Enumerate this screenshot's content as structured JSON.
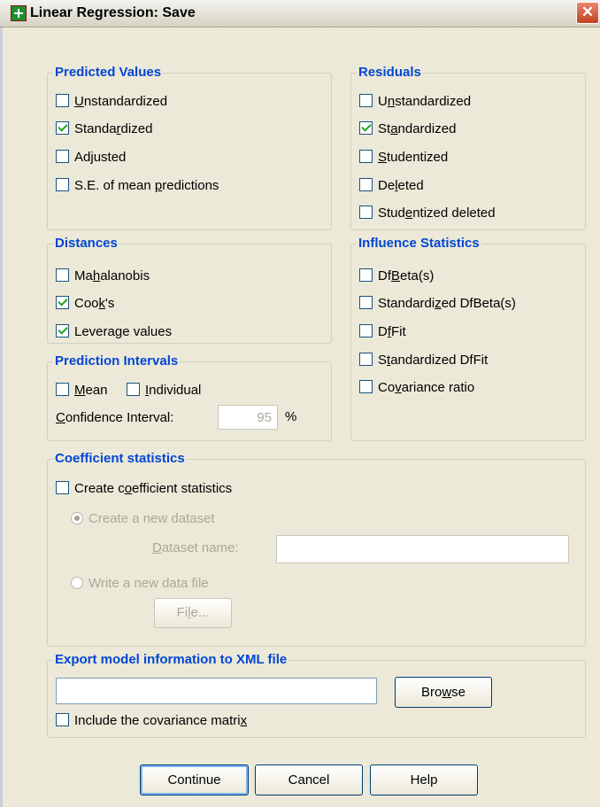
{
  "window": {
    "title": "Linear Regression: Save",
    "close_glyph": "✕"
  },
  "predicted_values": {
    "legend": "Predicted Values",
    "items": [
      {
        "pre": "",
        "u": "U",
        "post": "nstandardized",
        "checked": false
      },
      {
        "pre": "Standa",
        "u": "r",
        "post": "dized",
        "checked": true
      },
      {
        "pre": "Ad",
        "u": "j",
        "post": "usted",
        "checked": false
      },
      {
        "pre": "S.E. of mean ",
        "u": "p",
        "post": "redictions",
        "checked": false
      }
    ]
  },
  "residuals": {
    "legend": "Residuals",
    "items": [
      {
        "pre": "U",
        "u": "n",
        "post": "standardized",
        "checked": false
      },
      {
        "pre": "St",
        "u": "a",
        "post": "ndardized",
        "checked": true
      },
      {
        "pre": "",
        "u": "S",
        "post": "tudentized",
        "checked": false
      },
      {
        "pre": "De",
        "u": "l",
        "post": "eted",
        "checked": false
      },
      {
        "pre": "Stud",
        "u": "e",
        "post": "ntized deleted",
        "checked": false
      }
    ]
  },
  "distances": {
    "legend": "Distances",
    "items": [
      {
        "pre": "Ma",
        "u": "h",
        "post": "alanobis",
        "checked": false
      },
      {
        "pre": "Coo",
        "u": "k",
        "post": "'s",
        "checked": true
      },
      {
        "pre": "Levera",
        "u": "g",
        "post": "e values",
        "checked": true
      }
    ]
  },
  "influence": {
    "legend": "Influence Statistics",
    "items": [
      {
        "pre": "Df",
        "u": "B",
        "post": "eta(s)",
        "checked": false
      },
      {
        "pre": "Standardi",
        "u": "z",
        "post": "ed DfBeta(s)",
        "checked": false
      },
      {
        "pre": "D",
        "u": "f",
        "post": "Fit",
        "checked": false
      },
      {
        "pre": "S",
        "u": "t",
        "post": "andardized DfFit",
        "checked": false
      },
      {
        "pre": "Co",
        "u": "v",
        "post": "ariance ratio",
        "checked": false
      }
    ]
  },
  "prediction_intervals": {
    "legend": "Prediction Intervals",
    "mean": {
      "pre": "",
      "u": "M",
      "post": "ean",
      "checked": false
    },
    "individual": {
      "pre": "",
      "u": "I",
      "post": "ndividual",
      "checked": false
    },
    "ci_label": {
      "pre": "",
      "u": "C",
      "post": "onfidence Interval:"
    },
    "ci_value": "95",
    "ci_unit": "%"
  },
  "coefficient": {
    "legend": "Coefficient statistics",
    "create": {
      "pre": "Create c",
      "u": "o",
      "post": "efficient statistics",
      "checked": false
    },
    "new_dataset": {
      "label": "Create a new dataset",
      "selected": true
    },
    "dataset_name": {
      "pre": "",
      "u": "D",
      "post": "ataset name:",
      "value": ""
    },
    "write_file": {
      "label": "Write a new data file",
      "selected": false
    },
    "file_button": {
      "pre": "Fi",
      "u": "l",
      "post": "e..."
    }
  },
  "export": {
    "legend": "Export model information to XML file",
    "path_value": "",
    "browse": {
      "pre": "Bro",
      "u": "w",
      "post": "se"
    },
    "include_cov": {
      "pre": "Include the covariance matri",
      "u": "x",
      "post": "",
      "checked": false
    }
  },
  "buttons": {
    "continue": "Continue",
    "cancel": "Cancel",
    "help": "Help"
  }
}
